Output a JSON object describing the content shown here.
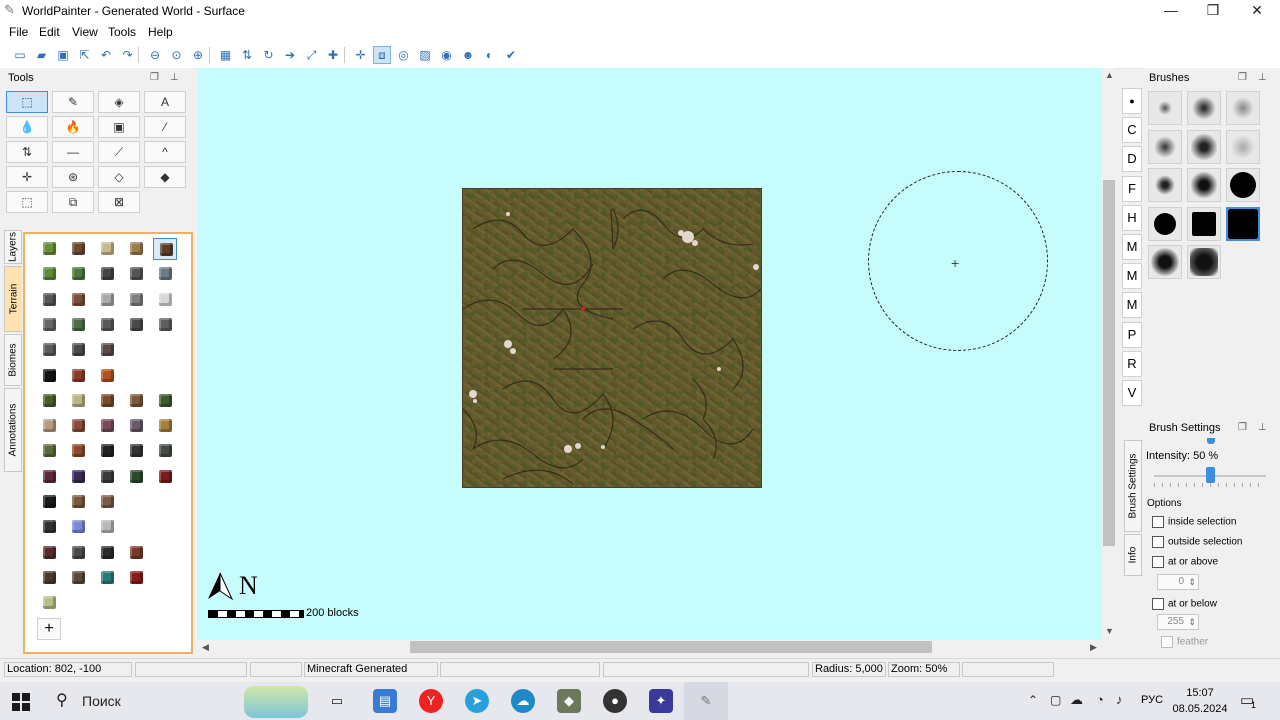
{
  "window": {
    "title": "WorldPainter - Generated World - Surface",
    "icon": "paint-brush-icon"
  },
  "menu": [
    "File",
    "Edit",
    "View",
    "Tools",
    "Help"
  ],
  "toolbar_icons": [
    "new-file-icon",
    "open-folder-icon",
    "save-icon",
    "export-icon",
    "undo-icon",
    "redo-icon",
    "zoom-out-icon",
    "zoom-reset-icon",
    "zoom-in-icon",
    "grid-icon",
    "height-icon",
    "rotate-icon",
    "move-icon",
    "scale-icon",
    "add-icon",
    "crosshair-icon",
    "fit-icon",
    "view-icon",
    "image-icon",
    "eye-icon",
    "user-icon",
    "globe-icon",
    "check-icon"
  ],
  "tools_panel": {
    "title": "Tools",
    "tools": [
      {
        "name": "select-tool",
        "glyph": "⬚",
        "selected": true
      },
      {
        "name": "pencil-tool",
        "glyph": "✎"
      },
      {
        "name": "flood-tool",
        "glyph": "◈"
      },
      {
        "name": "text-tool",
        "glyph": "A"
      },
      {
        "name": "water-tool",
        "glyph": "💧"
      },
      {
        "name": "lava-tool",
        "glyph": "🔥"
      },
      {
        "name": "image-tool",
        "glyph": "▣"
      },
      {
        "name": "eyedropper-tool",
        "glyph": "⁄"
      },
      {
        "name": "swap-tool",
        "glyph": "⇅"
      },
      {
        "name": "flatten-tool",
        "glyph": "—"
      },
      {
        "name": "slope-tool",
        "glyph": "⟋"
      },
      {
        "name": "raise-tool",
        "glyph": "^"
      },
      {
        "name": "sponge-tool",
        "glyph": "✛"
      },
      {
        "name": "smooth-tool",
        "glyph": "⊛"
      },
      {
        "name": "mountain-tool",
        "glyph": "◇"
      },
      {
        "name": "pyramid-tool",
        "glyph": "◆"
      },
      {
        "name": "selection-tool",
        "glyph": "⬚"
      },
      {
        "name": "copy-tool",
        "glyph": "⧉"
      },
      {
        "name": "clear-tool",
        "glyph": "⊠"
      }
    ]
  },
  "left_tabs": [
    "Layers",
    "Terrain",
    "Biomes",
    "Annotations"
  ],
  "terrain_rows": [
    [
      "#6a8f3a",
      "#6b4a32",
      "#c8b98a",
      "#9a7d4e",
      "#5a3e2a"
    ],
    [
      "#5e8b36",
      "#4d7a3c",
      "#444444",
      "#555555",
      "#6d7b86"
    ],
    [
      "#555555",
      "#7a4e36",
      "#a8a8a8",
      "#808080",
      "#d8d8d8"
    ],
    [
      "#666666",
      "#4f6b4a",
      "#585858",
      "#4a4a4a",
      "#5f5f5f"
    ],
    [
      "#5a5a5a",
      "#4a4a4a",
      "#5a4a4a"
    ],
    [
      "#111111",
      "#8b3a2a",
      "#b5501e"
    ],
    [
      "#4a5c2a",
      "#b8b58a",
      "#7a4a2a",
      "#7a5a3a",
      "#3e5a2a"
    ],
    [
      "#b89a7e",
      "#8b4a3a",
      "#7a4a5a",
      "#6a5a6a",
      "#a87e3a"
    ],
    [
      "#5a6b3a",
      "#8b4a2a",
      "#222222",
      "#333333",
      "#444c44"
    ],
    [
      "#5a2a3a",
      "#3a2a5a",
      "#3a3a3a",
      "#2a4a2a",
      "#7a1a1a"
    ],
    [
      "#1a1a1a",
      "#7a5a3a",
      "#7a5a4a"
    ],
    [
      "#333333",
      "#7a8ad8",
      "#b8b8b8"
    ],
    [
      "#5a2a2a",
      "#4a4a4a",
      "#2a2a2a",
      "#7a3a2a"
    ],
    [
      "#4a3a2a",
      "#5a4a3a",
      "#2a7a7a",
      "#8a1a1a"
    ],
    [
      "#b8c08a"
    ]
  ],
  "canvas": {
    "scale_label": "200 blocks",
    "north_label": "N"
  },
  "brush_letters": [
    "●",
    "C",
    "D",
    "F",
    "H",
    "M",
    "M",
    "M",
    "P",
    "R",
    "V"
  ],
  "brushes_panel": {
    "title": "Brushes"
  },
  "brush_settings": {
    "title": "Brush Settings",
    "intensity_label": "Intensity: 50 %",
    "intensity": 0.5,
    "options_label": "Options",
    "inside_selection": "inside selection",
    "outside_selection": "outside selection",
    "at_or_above": "at or above",
    "at_or_above_value": "0",
    "at_or_below": "at or below",
    "at_or_below_value": "255",
    "feather": "feather"
  },
  "right_vtabs": [
    "Brush Settings",
    "Info"
  ],
  "status": {
    "location": "Location: 802, -100",
    "world": "Minecraft Generated",
    "radius": "Radius: 5,000",
    "zoom": "Zoom: 50%"
  },
  "taskbar": {
    "search_placeholder": "Поиск",
    "lang": "РУС",
    "time": "15:07",
    "date": "08.05.2024",
    "notifications": "1"
  }
}
